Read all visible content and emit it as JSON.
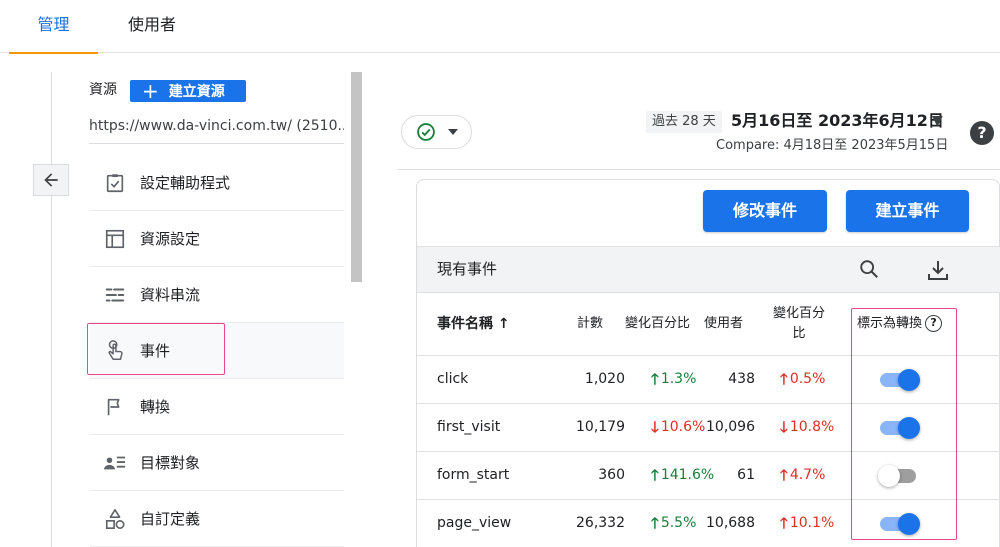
{
  "tabs": [
    {
      "label": "管理",
      "active": true
    },
    {
      "label": "使用者",
      "active": false
    }
  ],
  "sidebar": {
    "resource_label": "資源",
    "create_resource_label": "建立資源",
    "url": "https://www.da-vinci.com.tw/ (2510...",
    "items": [
      {
        "label": "設定輔助程式",
        "icon": "checklist-icon"
      },
      {
        "label": "資源設定",
        "icon": "layout-icon"
      },
      {
        "label": "資料串流",
        "icon": "data-stream-icon"
      },
      {
        "label": "事件",
        "icon": "touch-icon",
        "selected": true
      },
      {
        "label": "轉換",
        "icon": "flag-icon"
      },
      {
        "label": "目標對象",
        "icon": "audience-icon"
      },
      {
        "label": "自訂定義",
        "icon": "shapes-icon"
      }
    ]
  },
  "header": {
    "date_badge": "過去 28 天",
    "date_range": "5月16日至 2023年6月12日",
    "compare_text": "Compare: 4月18日至 2023年5月15日"
  },
  "card": {
    "modify_button": "修改事件",
    "create_button": "建立事件",
    "section_title": "現有事件"
  },
  "table": {
    "headers": {
      "event_name": "事件名稱 ↑",
      "count": "計數",
      "count_change": "變化百分比",
      "users": "使用者",
      "users_change_line1": "變化百分",
      "users_change_line2": "比",
      "mark_conversion": "標示為轉換"
    },
    "rows": [
      {
        "name": "click",
        "count": "1,020",
        "count_change": "1.3%",
        "count_dir": "up-g",
        "users": "438",
        "users_change": "0.5%",
        "users_dir": "up-r",
        "conversion": true
      },
      {
        "name": "first_visit",
        "count": "10,179",
        "count_change": "10.6%",
        "count_dir": "down-r",
        "users": "10,096",
        "users_change": "10.8%",
        "users_dir": "down-r",
        "conversion": true
      },
      {
        "name": "form_start",
        "count": "360",
        "count_change": "141.6%",
        "count_dir": "up-g",
        "users": "61",
        "users_change": "4.7%",
        "users_dir": "up-r",
        "conversion": false
      },
      {
        "name": "page_view",
        "count": "26,332",
        "count_change": "5.5%",
        "count_dir": "up-g",
        "users": "10,688",
        "users_change": "10.1%",
        "users_dir": "up-r",
        "conversion": true
      }
    ]
  },
  "colors": {
    "accent": "#1a73e8",
    "highlight": "#e8478e",
    "positive": "#188038",
    "negative": "#d93025"
  }
}
